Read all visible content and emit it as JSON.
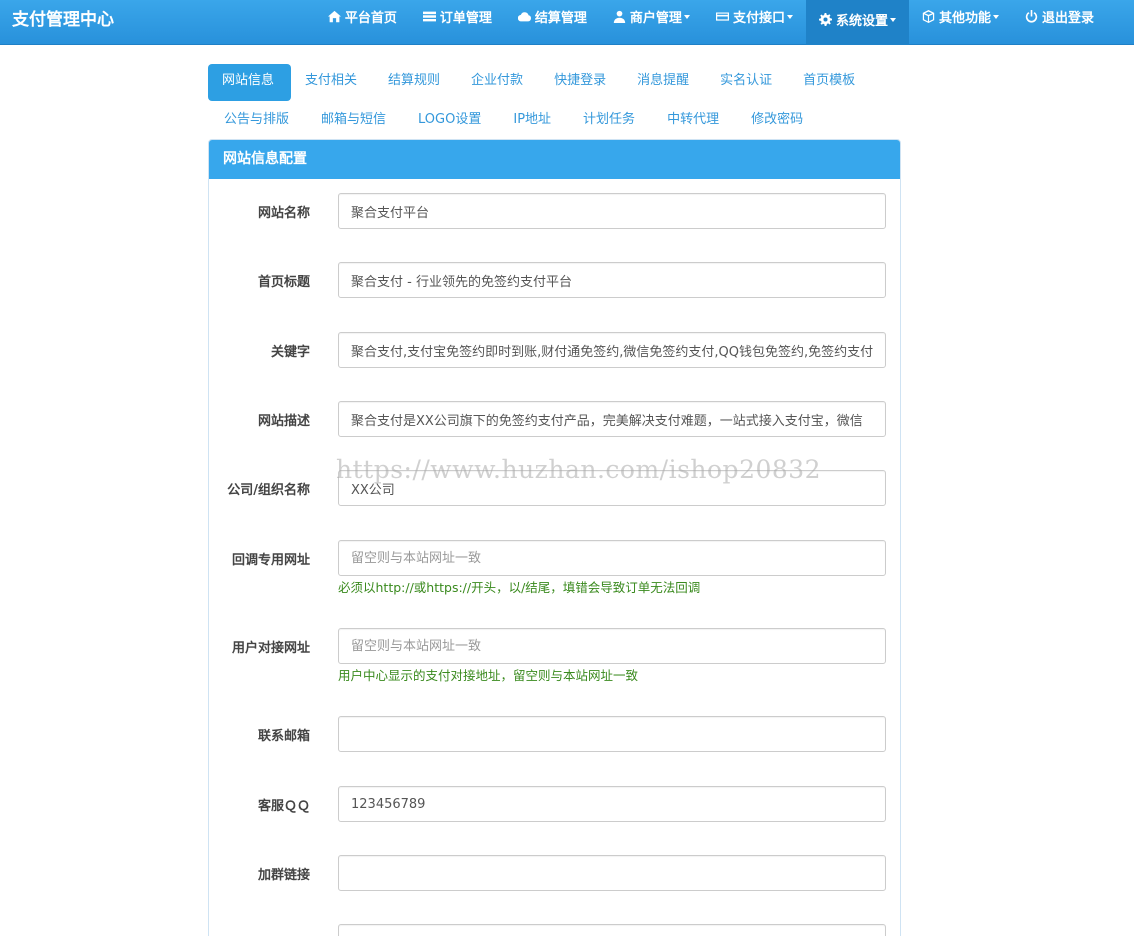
{
  "brand": "支付管理中心",
  "nav": [
    {
      "label": "平台首页",
      "icon": "home-icon",
      "dropdown": false
    },
    {
      "label": "订单管理",
      "icon": "list-icon",
      "dropdown": false
    },
    {
      "label": "结算管理",
      "icon": "cloud-icon",
      "dropdown": false
    },
    {
      "label": "商户管理",
      "icon": "user-icon",
      "dropdown": true
    },
    {
      "label": "支付接口",
      "icon": "credit-card-icon",
      "dropdown": true
    },
    {
      "label": "系统设置",
      "icon": "gear-icon",
      "dropdown": true,
      "active": true
    },
    {
      "label": "其他功能",
      "icon": "cube-icon",
      "dropdown": true
    },
    {
      "label": "退出登录",
      "icon": "power-icon",
      "dropdown": false
    }
  ],
  "tabs_row1": [
    "网站信息",
    "支付相关",
    "结算规则",
    "企业付款",
    "快捷登录",
    "消息提醒",
    "实名认证",
    "首页模板"
  ],
  "tabs_row2": [
    "公告与排版",
    "邮箱与短信",
    "LOGO设置",
    "IP地址",
    "计划任务",
    "中转代理",
    "修改密码"
  ],
  "panel_title": "网站信息配置",
  "fields": [
    {
      "label": "网站名称",
      "value": "聚合支付平台",
      "placeholder": ""
    },
    {
      "label": "首页标题",
      "value": "聚合支付 - 行业领先的免签约支付平台",
      "placeholder": ""
    },
    {
      "label": "关键字",
      "value": "聚合支付,支付宝免签约即时到账,财付通免签约,微信免签约支付,QQ钱包免签约,免签约支付",
      "placeholder": ""
    },
    {
      "label": "网站描述",
      "value": "聚合支付是XX公司旗下的免签约支付产品，完美解决支付难题，一站式接入支付宝，微信",
      "placeholder": ""
    },
    {
      "label": "公司/组织名称",
      "value": "XX公司",
      "placeholder": ""
    },
    {
      "label": "回调专用网址",
      "value": "",
      "placeholder": "留空则与本站网址一致",
      "help": "必须以http://或https://开头，以/结尾，填错会导致订单无法回调"
    },
    {
      "label": "用户对接网址",
      "value": "",
      "placeholder": "留空则与本站网址一致",
      "help": "用户中心显示的支付对接地址，留空则与本站网址一致"
    },
    {
      "label": "联系邮箱",
      "value": "",
      "placeholder": ""
    },
    {
      "label": "客服ＱＱ",
      "value": "123456789",
      "placeholder": ""
    },
    {
      "label": "加群链接",
      "value": "",
      "placeholder": ""
    },
    {
      "label": "",
      "value": "",
      "placeholder": ""
    }
  ],
  "watermark": "https://www.huzhan.com/ishop20832"
}
